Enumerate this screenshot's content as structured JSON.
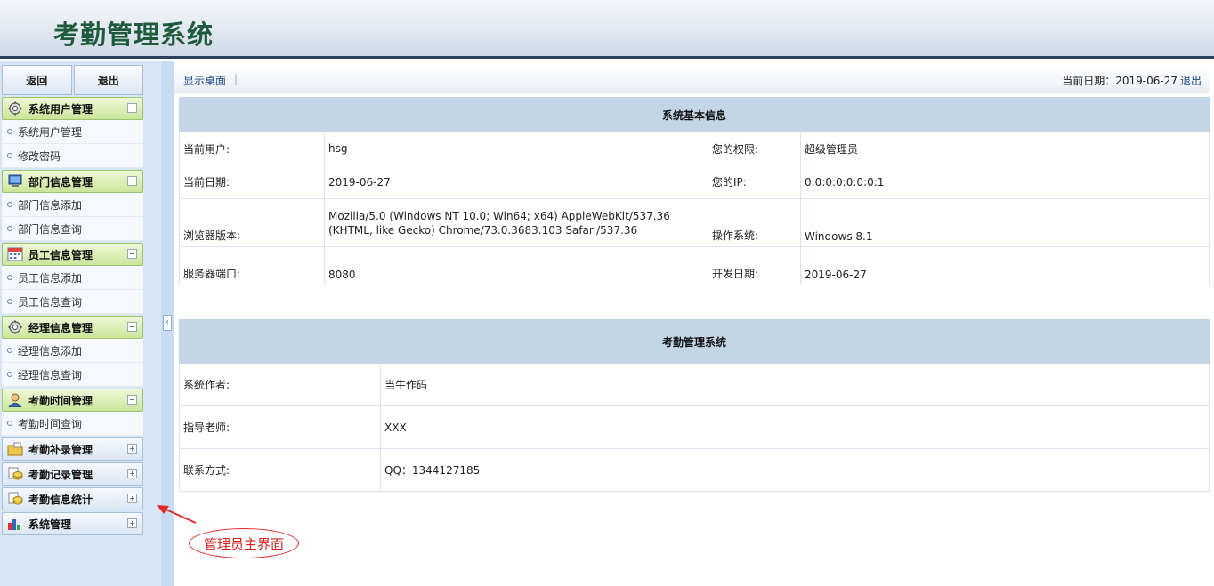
{
  "header": {
    "title": "考勤管理系统"
  },
  "sidebar": {
    "back_label": "返回",
    "exit_label": "退出",
    "groups": [
      {
        "label": "系统用户管理",
        "icon": "gear-icon",
        "expanded": true,
        "items": [
          "系统用户管理",
          "修改密码"
        ]
      },
      {
        "label": "部门信息管理",
        "icon": "monitor-icon",
        "expanded": true,
        "items": [
          "部门信息添加",
          "部门信息查询"
        ]
      },
      {
        "label": "员工信息管理",
        "icon": "calendar-icon",
        "expanded": true,
        "items": [
          "员工信息添加",
          "员工信息查询"
        ]
      },
      {
        "label": "经理信息管理",
        "icon": "gear-icon",
        "expanded": true,
        "items": [
          "经理信息添加",
          "经理信息查询"
        ]
      },
      {
        "label": "考勤时间管理",
        "icon": "user-icon",
        "expanded": true,
        "items": [
          "考勤时间查询"
        ]
      },
      {
        "label": "考勤补录管理",
        "icon": "folder-icon",
        "expanded": false,
        "items": []
      },
      {
        "label": "考勤记录管理",
        "icon": "coins-icon",
        "expanded": false,
        "items": []
      },
      {
        "label": "考勤信息统计",
        "icon": "coins-icon",
        "expanded": false,
        "items": []
      },
      {
        "label": "系统管理",
        "icon": "bar-chart-icon",
        "expanded": false,
        "items": []
      }
    ]
  },
  "toolbar": {
    "desktop_label": "显示桌面",
    "separator": "|",
    "date_prefix": "当前日期：2019-06-27",
    "logout_label": "退出"
  },
  "sysinfo": {
    "title": "系统基本信息",
    "rows": [
      {
        "k1": "当前用户:",
        "v1": "hsg",
        "k2": "您的权限:",
        "v2": "超级管理员"
      },
      {
        "k1": "当前日期:",
        "v1": "2019-06-27",
        "k2": "您的IP:",
        "v2": "0:0:0:0:0:0:0:1"
      },
      {
        "k1": "浏览器版本:",
        "v1": "Mozilla/5.0 (Windows NT 10.0; Win64; x64) AppleWebKit/537.36 (KHTML, like Gecko) Chrome/73.0.3683.103 Safari/537.36",
        "k2": "操作系统:",
        "v2": "Windows 8.1"
      },
      {
        "k1": "服务器端口:",
        "v1": "8080",
        "k2": "开发日期:",
        "v2": "2019-06-27"
      }
    ]
  },
  "about": {
    "title": "考勤管理系统",
    "rows": [
      {
        "k": "系统作者:",
        "v": "当牛作码"
      },
      {
        "k": "指导老师:",
        "v": "XXX"
      },
      {
        "k": "联系方式:",
        "v": "QQ：1344127185"
      }
    ]
  },
  "annotation": {
    "text": "管理员主界面",
    "color": "#d42020"
  }
}
